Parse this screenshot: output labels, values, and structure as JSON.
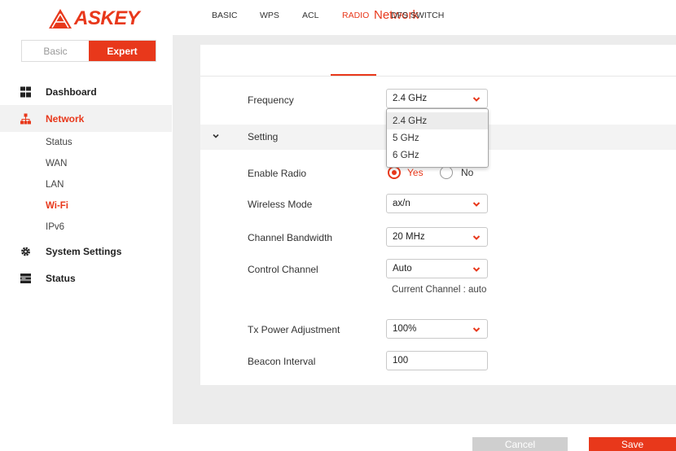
{
  "brand": {
    "name": "ASKEY",
    "color": "#e8381b"
  },
  "header": {
    "title": "Network"
  },
  "mode_switch": {
    "basic": "Basic",
    "expert": "Expert",
    "selected": "Expert"
  },
  "sidebar": {
    "items": [
      {
        "label": "Dashboard",
        "icon": "dashboard-icon"
      },
      {
        "label": "Network",
        "icon": "network-icon",
        "active": true
      },
      {
        "label": "System Settings",
        "icon": "gear-icon"
      },
      {
        "label": "Status",
        "icon": "status-icon"
      }
    ],
    "network_sub": [
      {
        "label": "Status"
      },
      {
        "label": "WAN"
      },
      {
        "label": "LAN"
      },
      {
        "label": "Wi-Fi",
        "active": true
      },
      {
        "label": "IPv6"
      }
    ]
  },
  "tabs": [
    {
      "label": "BASIC"
    },
    {
      "label": "WPS"
    },
    {
      "label": "ACL"
    },
    {
      "label": "RADIO",
      "active": true
    },
    {
      "label": "DFS SWITCH"
    }
  ],
  "form": {
    "frequency": {
      "label": "Frequency",
      "value": "2.4 GHz",
      "options": [
        "2.4 GHz",
        "5 GHz",
        "6 GHz"
      ]
    },
    "section": {
      "label": "Setting"
    },
    "enable_radio": {
      "label": "Enable Radio",
      "yes": "Yes",
      "no": "No",
      "selected": "Yes"
    },
    "wireless_mode": {
      "label": "Wireless Mode",
      "value": "ax/n"
    },
    "channel_bandwidth": {
      "label": "Channel Bandwidth",
      "value": "20 MHz"
    },
    "control_channel": {
      "label": "Control Channel",
      "value": "Auto",
      "current": "Current Channel : auto"
    },
    "tx_power": {
      "label": "Tx Power Adjustment",
      "value": "100%"
    },
    "beacon_interval": {
      "label": "Beacon Interval",
      "value": "100"
    }
  },
  "actions": {
    "cancel": "Cancel",
    "save": "Save"
  }
}
